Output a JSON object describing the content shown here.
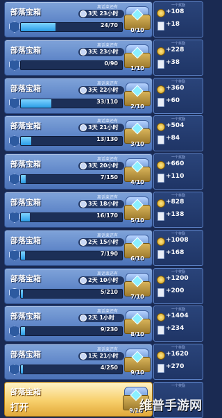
{
  "rows": [
    {
      "title": "部落宝箱",
      "progress": "24/70",
      "progress_frac": 0.34,
      "time_label": "离话束还有",
      "time": "3天 23小时",
      "count": "0/10",
      "gold": "+108",
      "cards": "+18"
    },
    {
      "title": "部落宝箱",
      "progress": "0/90",
      "progress_frac": 0.0,
      "time_label": "离话束还有",
      "time": "3天 23小时",
      "count": "1/10",
      "gold": "+228",
      "cards": "+38"
    },
    {
      "title": "部落宝箱",
      "progress": "33/110",
      "progress_frac": 0.3,
      "time_label": "离话束还有",
      "time": "3天 22小时",
      "count": "2/10",
      "gold": "+360",
      "cards": "+60"
    },
    {
      "title": "部落宝箱",
      "progress": "13/130",
      "progress_frac": 0.1,
      "time_label": "离话束还有",
      "time": "3天 21小时",
      "count": "3/10",
      "gold": "+504",
      "cards": "+84"
    },
    {
      "title": "部落宝箱",
      "progress": "7/150",
      "progress_frac": 0.05,
      "time_label": "离话束还有",
      "time": "3天 20小时",
      "count": "4/10",
      "gold": "+660",
      "cards": "+110"
    },
    {
      "title": "部落宝箱",
      "progress": "16/170",
      "progress_frac": 0.09,
      "time_label": "离话束还有",
      "time": "3天 18小时",
      "count": "5/10",
      "gold": "+828",
      "cards": "+138"
    },
    {
      "title": "部落宝箱",
      "progress": "7/190",
      "progress_frac": 0.04,
      "time_label": "离话束还有",
      "time": "2天 15小时",
      "count": "6/10",
      "gold": "+1008",
      "cards": "+168"
    },
    {
      "title": "部落宝箱",
      "progress": "5/210",
      "progress_frac": 0.02,
      "time_label": "离话束还有",
      "time": "2天 10小时",
      "count": "7/10",
      "gold": "+1200",
      "cards": "+200"
    },
    {
      "title": "部落宝箱",
      "progress": "9/230",
      "progress_frac": 0.04,
      "time_label": "离话束还有",
      "time": "2天 1小时",
      "count": "8/10",
      "gold": "+1404",
      "cards": "+234"
    },
    {
      "title": "部落宝箱",
      "progress": "4/250",
      "progress_frac": 0.02,
      "time_label": "离话束还有",
      "time": "1天 21小时",
      "count": "9/10",
      "gold": "+1620",
      "cards": "+270"
    }
  ],
  "reward_header": "一个奖励",
  "open": {
    "title": "部落宝箱",
    "action": "打开",
    "count": "9/10"
  },
  "watermark": "维普手游网"
}
